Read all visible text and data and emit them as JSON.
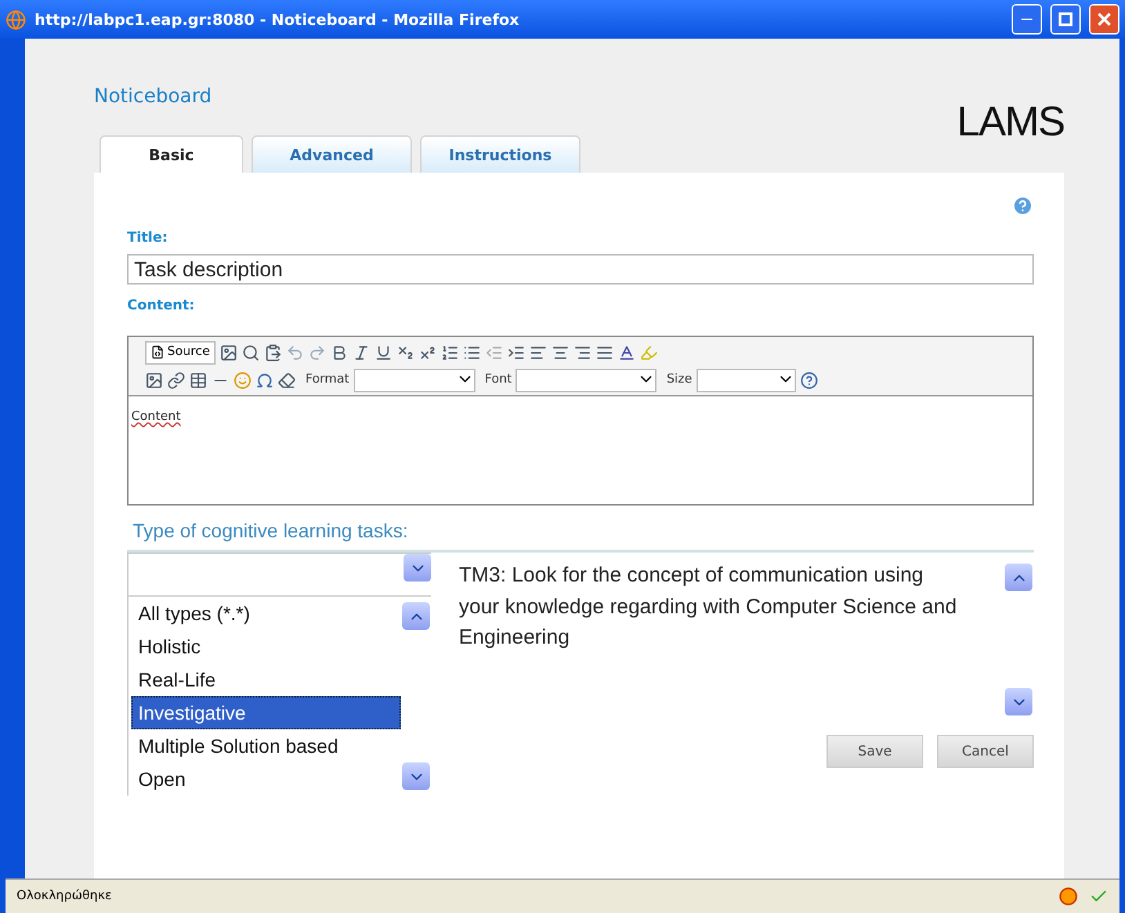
{
  "window": {
    "title": "http://labpc1.eap.gr:8080 - Noticeboard - Mozilla Firefox"
  },
  "page": {
    "heading": "Noticeboard",
    "logo": "LAMS"
  },
  "tabs": [
    {
      "label": "Basic",
      "selected": true
    },
    {
      "label": "Advanced",
      "selected": false
    },
    {
      "label": "Instructions",
      "selected": false
    }
  ],
  "title_field": {
    "label": "Title:",
    "value": "Task description"
  },
  "content_editor": {
    "label": "Content:",
    "source_label": "Source",
    "format_label": "Format",
    "font_label": "Font",
    "size_label": "Size",
    "value": "Content"
  },
  "tasks": {
    "label": "Type of cognitive learning tasks:",
    "options": [
      {
        "label": "All types (*.*)",
        "selected": false
      },
      {
        "label": "Holistic",
        "selected": false
      },
      {
        "label": "Real-Life",
        "selected": false
      },
      {
        "label": "Investigative",
        "selected": true
      },
      {
        "label": "Multiple Solution based",
        "selected": false
      },
      {
        "label": "Open",
        "selected": false
      }
    ],
    "description": "TM3: Look for the concept of communication using your knowledge regarding with Computer Science and Engineering"
  },
  "buttons": [
    "Save",
    "Cancel"
  ],
  "status_bar": {
    "text": "Ολοκληρώθηκε"
  }
}
